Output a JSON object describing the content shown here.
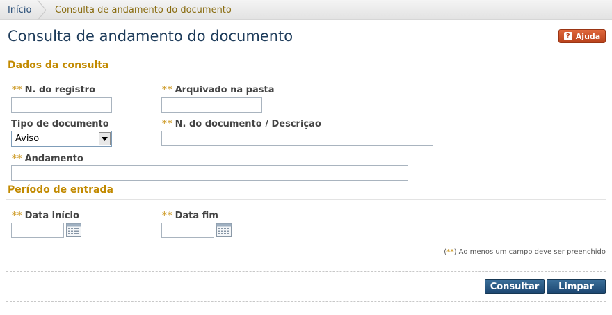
{
  "breadcrumb": {
    "home": "Início",
    "current": "Consulta de andamento do documento"
  },
  "page": {
    "title": "Consulta de andamento do documento",
    "help_label": "Ajuda",
    "help_icon": "?"
  },
  "sections": {
    "query": "Dados da consulta",
    "period": "Período de entrada"
  },
  "fields": {
    "required_marker": "**",
    "registro": {
      "label": "N. do registro",
      "value": ""
    },
    "pasta": {
      "label": "Arquivado na pasta",
      "value": ""
    },
    "tipo": {
      "label": "Tipo de documento",
      "value": "Aviso"
    },
    "numero_descricao": {
      "label": "N. do documento / Descrição",
      "value": ""
    },
    "andamento": {
      "label": "Andamento",
      "value": ""
    },
    "data_inicio": {
      "label": "Data início",
      "value": ""
    },
    "data_fim": {
      "label": "Data fim",
      "value": ""
    }
  },
  "hint": {
    "open": "(",
    "marker": "**",
    "close": ")",
    "text": " Ao menos um campo deve ser preenchido"
  },
  "buttons": {
    "consultar": "Consultar",
    "limpar": "Limpar"
  },
  "colors": {
    "accent": "#c28a00",
    "title": "#1d3b5a",
    "button": "#1c4670",
    "help": "#b8421c"
  },
  "icons": [
    "chevron-right-icon",
    "question-icon",
    "dropdown-arrow-icon",
    "calendar-icon"
  ]
}
